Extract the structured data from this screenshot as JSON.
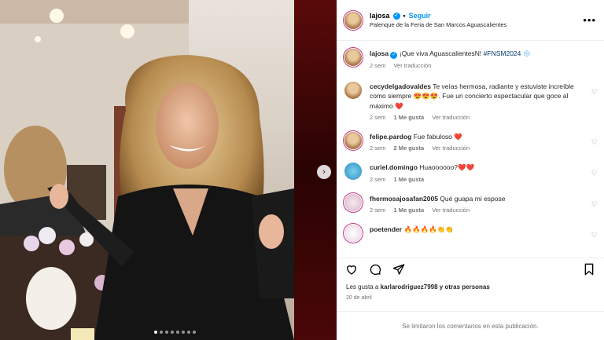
{
  "post": {
    "username": "lajosa",
    "follow_label": "Seguir",
    "location": "Palenque de la Feria de San Marcos Aguascalientes",
    "more_icon": "more-horizontal-icon"
  },
  "caption": {
    "username": "lajosa",
    "text": "¡Que viva AguascalientesN!",
    "hashtag": "#FNSM2024",
    "emoji": "❄️",
    "time": "2 sem",
    "translate": "Ver traducción"
  },
  "comments": [
    {
      "username": "cecydelgadovaldes",
      "text": "Te veías hermosa, radiante y estuviste increíble como siempre 😍😍😍. Fue un concierto espectacular que goce al máximo ❤️",
      "time": "2 sem",
      "likes": "1 Me gusta",
      "translate": "Ver traducción"
    },
    {
      "username": "felipe.pardog",
      "text": "Fue fabuloso ❤️",
      "time": "2 sem",
      "likes": "2 Me gusta",
      "translate": "Ver traducción"
    },
    {
      "username": "curiel.domingo",
      "text": "Huaoooooo?❤️❤️",
      "time": "2 sem",
      "likes": "1 Me gusta",
      "translate": ""
    },
    {
      "username": "fhermosajosafan2005",
      "text": "Qué guapa mi espose",
      "time": "2 sem",
      "likes": "1 Me gusta",
      "translate": "Ver traducción"
    },
    {
      "username": "poetender",
      "text": "🔥🔥🔥🔥👏👏",
      "time": "",
      "likes": "",
      "translate": ""
    }
  ],
  "actions": {
    "like_icon": "heart-icon",
    "comment_icon": "comment-icon",
    "share_icon": "share-icon",
    "save_icon": "bookmark-icon"
  },
  "likes_text": {
    "prefix": "Les gusta a",
    "user": "karlarodriguez7998",
    "suffix": "y otras personas"
  },
  "date": "20 de abril",
  "footer": "Se limitaron los comentarios en esta publicación.",
  "colors": {
    "accent": "#0095f6",
    "link": "#00376b",
    "muted": "#737373",
    "heart": "#ed4956"
  }
}
